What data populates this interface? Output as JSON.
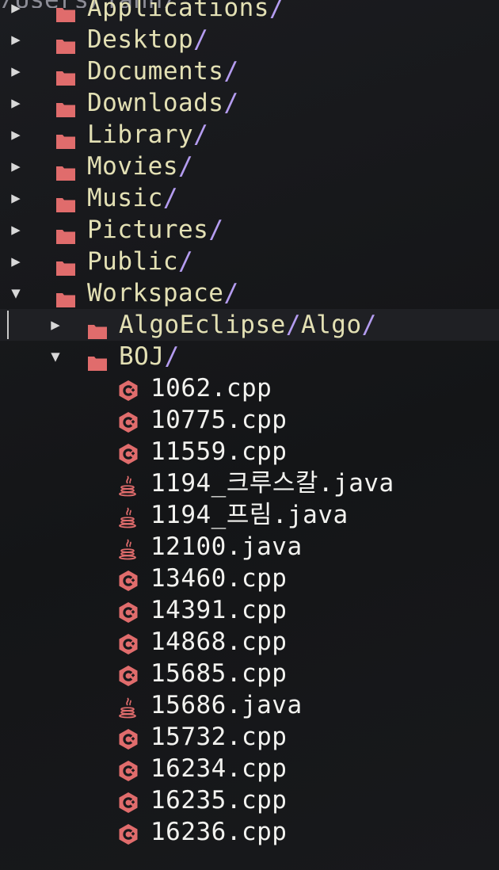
{
  "header": {
    "path": "/Users/jahn/"
  },
  "tree": {
    "root_folders": [
      {
        "name": "Applications",
        "slash": "/",
        "expanded": false
      },
      {
        "name": "Desktop",
        "slash": "/",
        "expanded": false
      },
      {
        "name": "Documents",
        "slash": "/",
        "expanded": false
      },
      {
        "name": "Downloads",
        "slash": "/",
        "expanded": false
      },
      {
        "name": "Library",
        "slash": "/",
        "expanded": false
      },
      {
        "name": "Movies",
        "slash": "/",
        "expanded": false
      },
      {
        "name": "Music",
        "slash": "/",
        "expanded": false
      },
      {
        "name": "Pictures",
        "slash": "/",
        "expanded": false
      },
      {
        "name": "Public",
        "slash": "/",
        "expanded": false
      },
      {
        "name": "Workspace",
        "slash": "/",
        "expanded": true
      }
    ],
    "workspace_children": [
      {
        "name": "AlgoEclipse",
        "slash1": "/",
        "name2": "Algo",
        "slash2": "/",
        "expanded": false,
        "cursor": true
      },
      {
        "name": "BOJ",
        "slash": "/",
        "expanded": true
      }
    ],
    "boj_files": [
      {
        "name": "1062.cpp",
        "icon": "cpp-icon"
      },
      {
        "name": "10775.cpp",
        "icon": "cpp-icon"
      },
      {
        "name": "11559.cpp",
        "icon": "cpp-icon"
      },
      {
        "name": "1194_크루스칼.java",
        "icon": "java-icon"
      },
      {
        "name": "1194_프림.java",
        "icon": "java-icon"
      },
      {
        "name": "12100.java",
        "icon": "java-icon"
      },
      {
        "name": "13460.cpp",
        "icon": "cpp-icon"
      },
      {
        "name": "14391.cpp",
        "icon": "cpp-icon"
      },
      {
        "name": "14868.cpp",
        "icon": "cpp-icon"
      },
      {
        "name": "15685.cpp",
        "icon": "cpp-icon"
      },
      {
        "name": "15686.java",
        "icon": "java-icon"
      },
      {
        "name": "15732.cpp",
        "icon": "cpp-icon"
      },
      {
        "name": "16234.cpp",
        "icon": "cpp-icon"
      },
      {
        "name": "16235.cpp",
        "icon": "cpp-icon"
      },
      {
        "name": "16236.cpp",
        "icon": "cpp-icon"
      }
    ],
    "arrows": {
      "collapsed": "▶",
      "expanded": "▼"
    }
  },
  "colors": {
    "background": "#17181b",
    "folder": "#e06c6c",
    "folder_name": "#e3e0b4",
    "slash": "#b49cf0",
    "file_name": "#f2f2ef",
    "cpp_icon": "#e06c6c",
    "java_icon": "#e06c6c"
  }
}
